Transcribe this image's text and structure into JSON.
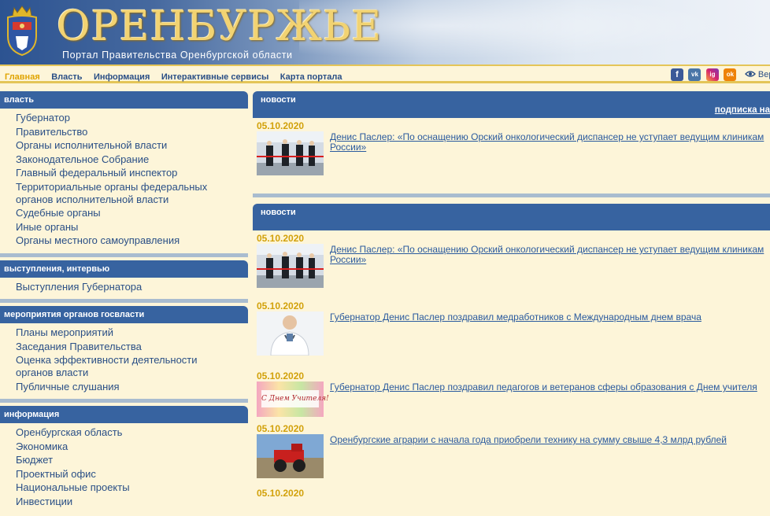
{
  "header": {
    "title": "ОРЕНБУРЖЬЕ",
    "subtitle": "Портал Правительства Оренбургской области"
  },
  "topmenu": {
    "items": [
      "Главная",
      "Власть",
      "Информация",
      "Интерактивные сервисы",
      "Карта портала"
    ],
    "active_index": 0,
    "version_label": "Верс"
  },
  "social": {
    "facebook": "f",
    "vk": "vk",
    "instagram": "ig",
    "odnoklassniki": "ok"
  },
  "sidebar": {
    "sections": [
      {
        "title": "власть",
        "items": [
          "Губернатор",
          "Правительство",
          "Органы исполнительной власти",
          "Законодательное Собрание",
          "Главный федеральный инспектор",
          "Территориальные органы федеральных",
          "органов исполнительной власти",
          "Судебные органы",
          "Иные органы",
          "Органы местного самоуправления"
        ]
      },
      {
        "title": "выступления, интервью",
        "items": [
          "Выступления Губернатора"
        ]
      },
      {
        "title": "мероприятия органов госвласти",
        "items": [
          "Планы мероприятий",
          "Заседания Правительства",
          "Оценка эффективности деятельности",
          "органов власти",
          "Публичные слушания"
        ]
      },
      {
        "title": "информация",
        "items": [
          "Оренбургская область",
          "Экономика",
          "Бюджет",
          "Проектный офис",
          "Национальные проекты",
          "Инвестиции"
        ]
      }
    ]
  },
  "main": {
    "block1": {
      "title": "новости",
      "subscribe": "подписка на",
      "news": [
        {
          "date": "05.10.2020",
          "title_line1": "Денис Паслер: «По оснащению Орский онкологический диспансер не уступает ведущим клиникам",
          "title_line2": "России»"
        }
      ]
    },
    "block2": {
      "title": "новости",
      "news": [
        {
          "date": "05.10.2020",
          "title_line1": "Денис Паслер: «По оснащению Орский онкологический диспансер не уступает ведущим клиникам",
          "title_line2": "России»"
        },
        {
          "date": "05.10.2020",
          "title_line1": "Губернатор Денис Паслер поздравил медработников с Международным днем врача",
          "title_line2": ""
        },
        {
          "date": "05.10.2020",
          "title_line1": "Губернатор Денис Паслер поздравил педагогов и ветеранов сферы образования с Днем учителя",
          "title_line2": ""
        },
        {
          "date": "05.10.2020",
          "title_line1": "Оренбургские аграрии с начала года приобрели технику на сумму свыше 4,3 млрд рублей",
          "title_line2": ""
        },
        {
          "date": "05.10.2020",
          "title_line1": "",
          "title_line2": ""
        }
      ],
      "teacher_card_text": "С Днем Учителя!"
    }
  },
  "colors": {
    "header_blue": "#3763a0",
    "accent_gold": "#e0a400",
    "link_blue": "#2a5a9e",
    "background": "#fdf5d9"
  }
}
